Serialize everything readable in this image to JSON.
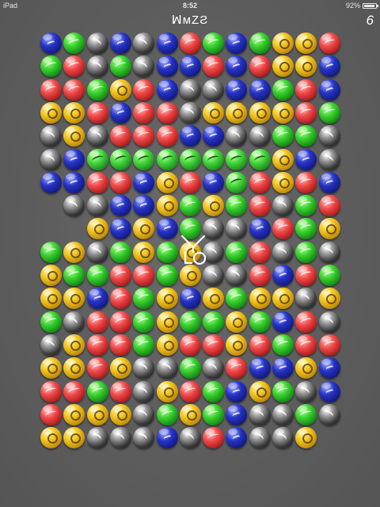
{
  "status_bar": {
    "device": "iPad",
    "time": "8:52",
    "battery": "92%",
    "battery_level": 0.92
  },
  "title": "ꟽᴍZƧ",
  "score": "6",
  "board": {
    "cols": 13,
    "rows": 18,
    "color_key": {
      "g": "green",
      "r": "red",
      "b": "blue",
      "y": "yellow",
      "k": "black-white"
    },
    "rows_data": [
      "bgkbkbrgbgyyr",
      "grkgkbbrbryyb",
      "rrgyrbkkbbgrb",
      "yyrbrrkyyyyrg",
      "kykrrrbbkkggk",
      "kbGGGGGGGGybk",
      "bbrrbyrbGryrb",
      " kkbbygygrkgr",
      "  ybybgkkbrgy",
      "gykgygykgrkgk",
      "yggrrgykkrbrg",
      "yybrgybygyyky",
      "gkrrgyggygbrk",
      "kyrrgyrryrgrr",
      "yyrykkgkrbbyb",
      "rrgrkyrgbygkb",
      "ryyykgygbkkgk",
      "yykkkbkrbkky "
    ]
  },
  "overlay": {
    "marker_icon": "pointer-marker-icon"
  }
}
